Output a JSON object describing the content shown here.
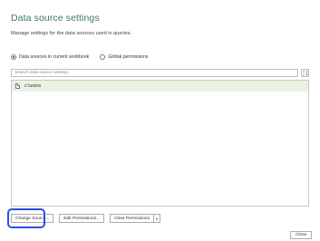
{
  "dialog": {
    "title": "Data source settings",
    "subtitle": "Manage settings for the data sources used in queries."
  },
  "scope": {
    "options": [
      {
        "label": "Data sources in current workbook",
        "selected": true
      },
      {
        "label": "Global permissions",
        "selected": false
      }
    ]
  },
  "search": {
    "placeholder": "Search data source settings",
    "value": ""
  },
  "sort_icon": "sort-az-icon",
  "list": {
    "items": [
      {
        "label": "c:\\users",
        "icon": "file-icon",
        "selected": true
      }
    ]
  },
  "buttons": {
    "change_source": "Change Source...",
    "edit_permissions": "Edit Permissions...",
    "clear_permissions": "Clear Permissions",
    "close": "Close"
  },
  "colors": {
    "title": "#3b7a5c",
    "selected_row": "#e8f3e4",
    "highlight": "#2b4fe0"
  }
}
